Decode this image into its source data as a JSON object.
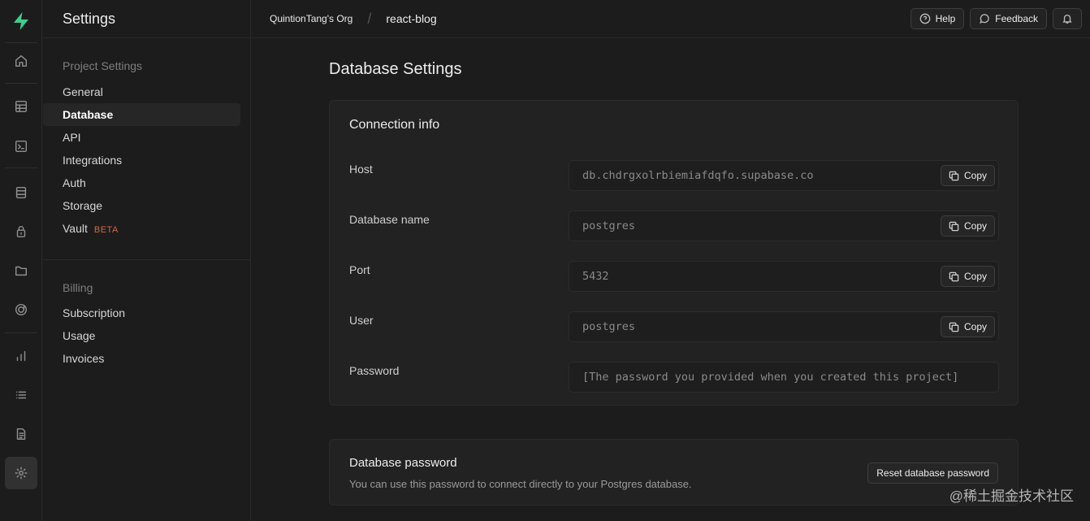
{
  "rail": {
    "logo": "supabase-logo",
    "icons": [
      "home-icon",
      "table-editor-icon",
      "sql-editor-icon",
      "database-icon",
      "auth-lock-icon",
      "storage-icon",
      "api-icon",
      "reports-icon",
      "logs-icon",
      "docs-icon",
      "settings-icon"
    ],
    "active": "settings-icon"
  },
  "sidebar": {
    "title": "Settings",
    "project_group": "Project Settings",
    "project_items": [
      "General",
      "Database",
      "API",
      "Integrations",
      "Auth",
      "Storage",
      "Vault"
    ],
    "vault_badge": "BETA",
    "active_item": "Database",
    "billing_group": "Billing",
    "billing_items": [
      "Subscription",
      "Usage",
      "Invoices"
    ]
  },
  "topbar": {
    "org": "QuintionTang's Org",
    "separator": "/",
    "project": "react-blog",
    "help": "Help",
    "feedback": "Feedback"
  },
  "main": {
    "title": "Database Settings",
    "connection": {
      "title": "Connection info",
      "copy_label": "Copy",
      "rows": [
        {
          "label": "Host",
          "value": "db.chdrgxolrbiemiafdqfo.supabase.co"
        },
        {
          "label": "Database name",
          "value": "postgres"
        },
        {
          "label": "Port",
          "value": "5432"
        },
        {
          "label": "User",
          "value": "postgres"
        },
        {
          "label": "Password",
          "value": "[The password you provided when you created this project]"
        }
      ]
    },
    "password": {
      "title": "Database password",
      "description": "You can use this password to connect directly to your Postgres database.",
      "reset_button": "Reset database password"
    }
  },
  "watermark": "@稀土掘金技术社区"
}
